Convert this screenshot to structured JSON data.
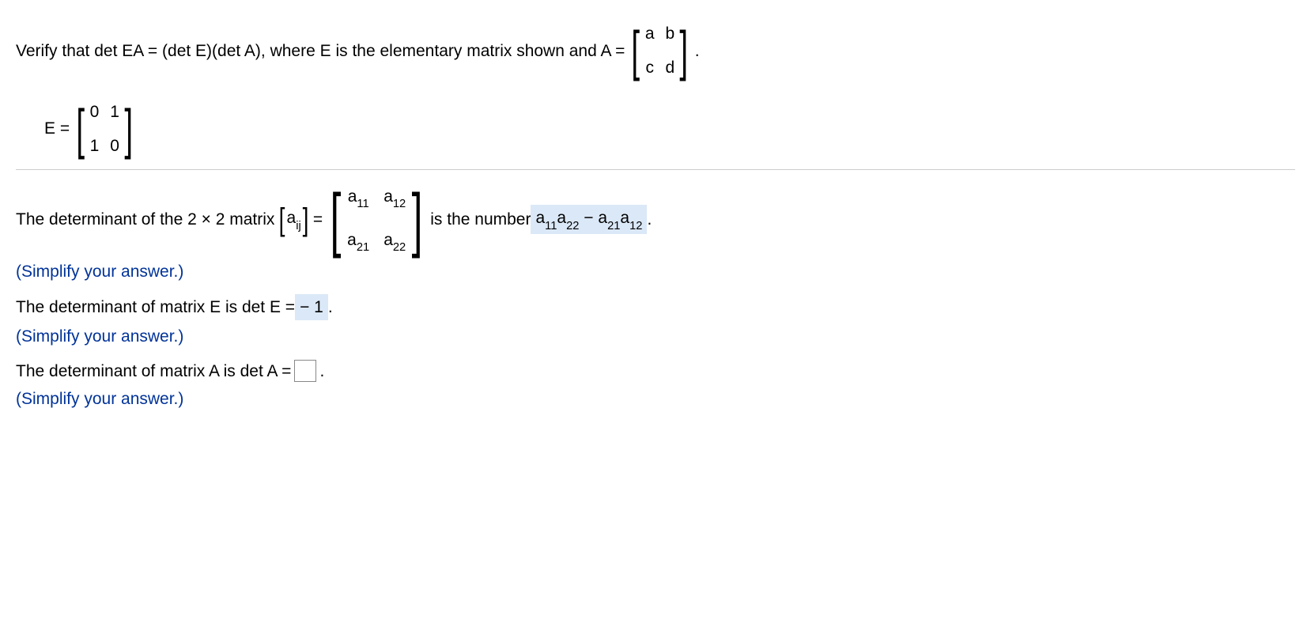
{
  "question": {
    "prefix": "Verify that det EA = (det E)(det A), where E is the elementary matrix shown and A =",
    "matrixA": {
      "r1c1": "a",
      "r1c2": "b",
      "r2c1": "c",
      "r2c2": "d"
    },
    "period": "."
  },
  "given": {
    "label": "E =",
    "matrixE": {
      "r1c1": "0",
      "r1c2": "1",
      "r2c1": "1",
      "r2c2": "0"
    }
  },
  "step1": {
    "prefix": "The determinant of the 2 × 2 matrix ",
    "aij": "a",
    "aij_sub": "ij",
    "equals": " = ",
    "matrix": {
      "r1c1_a": "a",
      "r1c1_s": "11",
      "r1c2_a": "a",
      "r1c2_s": "12",
      "r2c1_a": "a",
      "r2c1_s": "21",
      "r2c2_a": "a",
      "r2c2_s": "22"
    },
    "mid": " is the number ",
    "answer_a1": "a",
    "answer_s1": "11",
    "answer_a2": "a",
    "answer_s2": "22",
    "minus": " − ",
    "answer_a3": "a",
    "answer_s3": "21",
    "answer_a4": "a",
    "answer_s4": "12",
    "period": " ."
  },
  "simplify": "(Simplify your answer.)",
  "step2": {
    "prefix": "The determinant of matrix E is det E = ",
    "answer": " − 1",
    "period": " ."
  },
  "step3": {
    "prefix": "The determinant of matrix A is det A =",
    "period": "."
  }
}
